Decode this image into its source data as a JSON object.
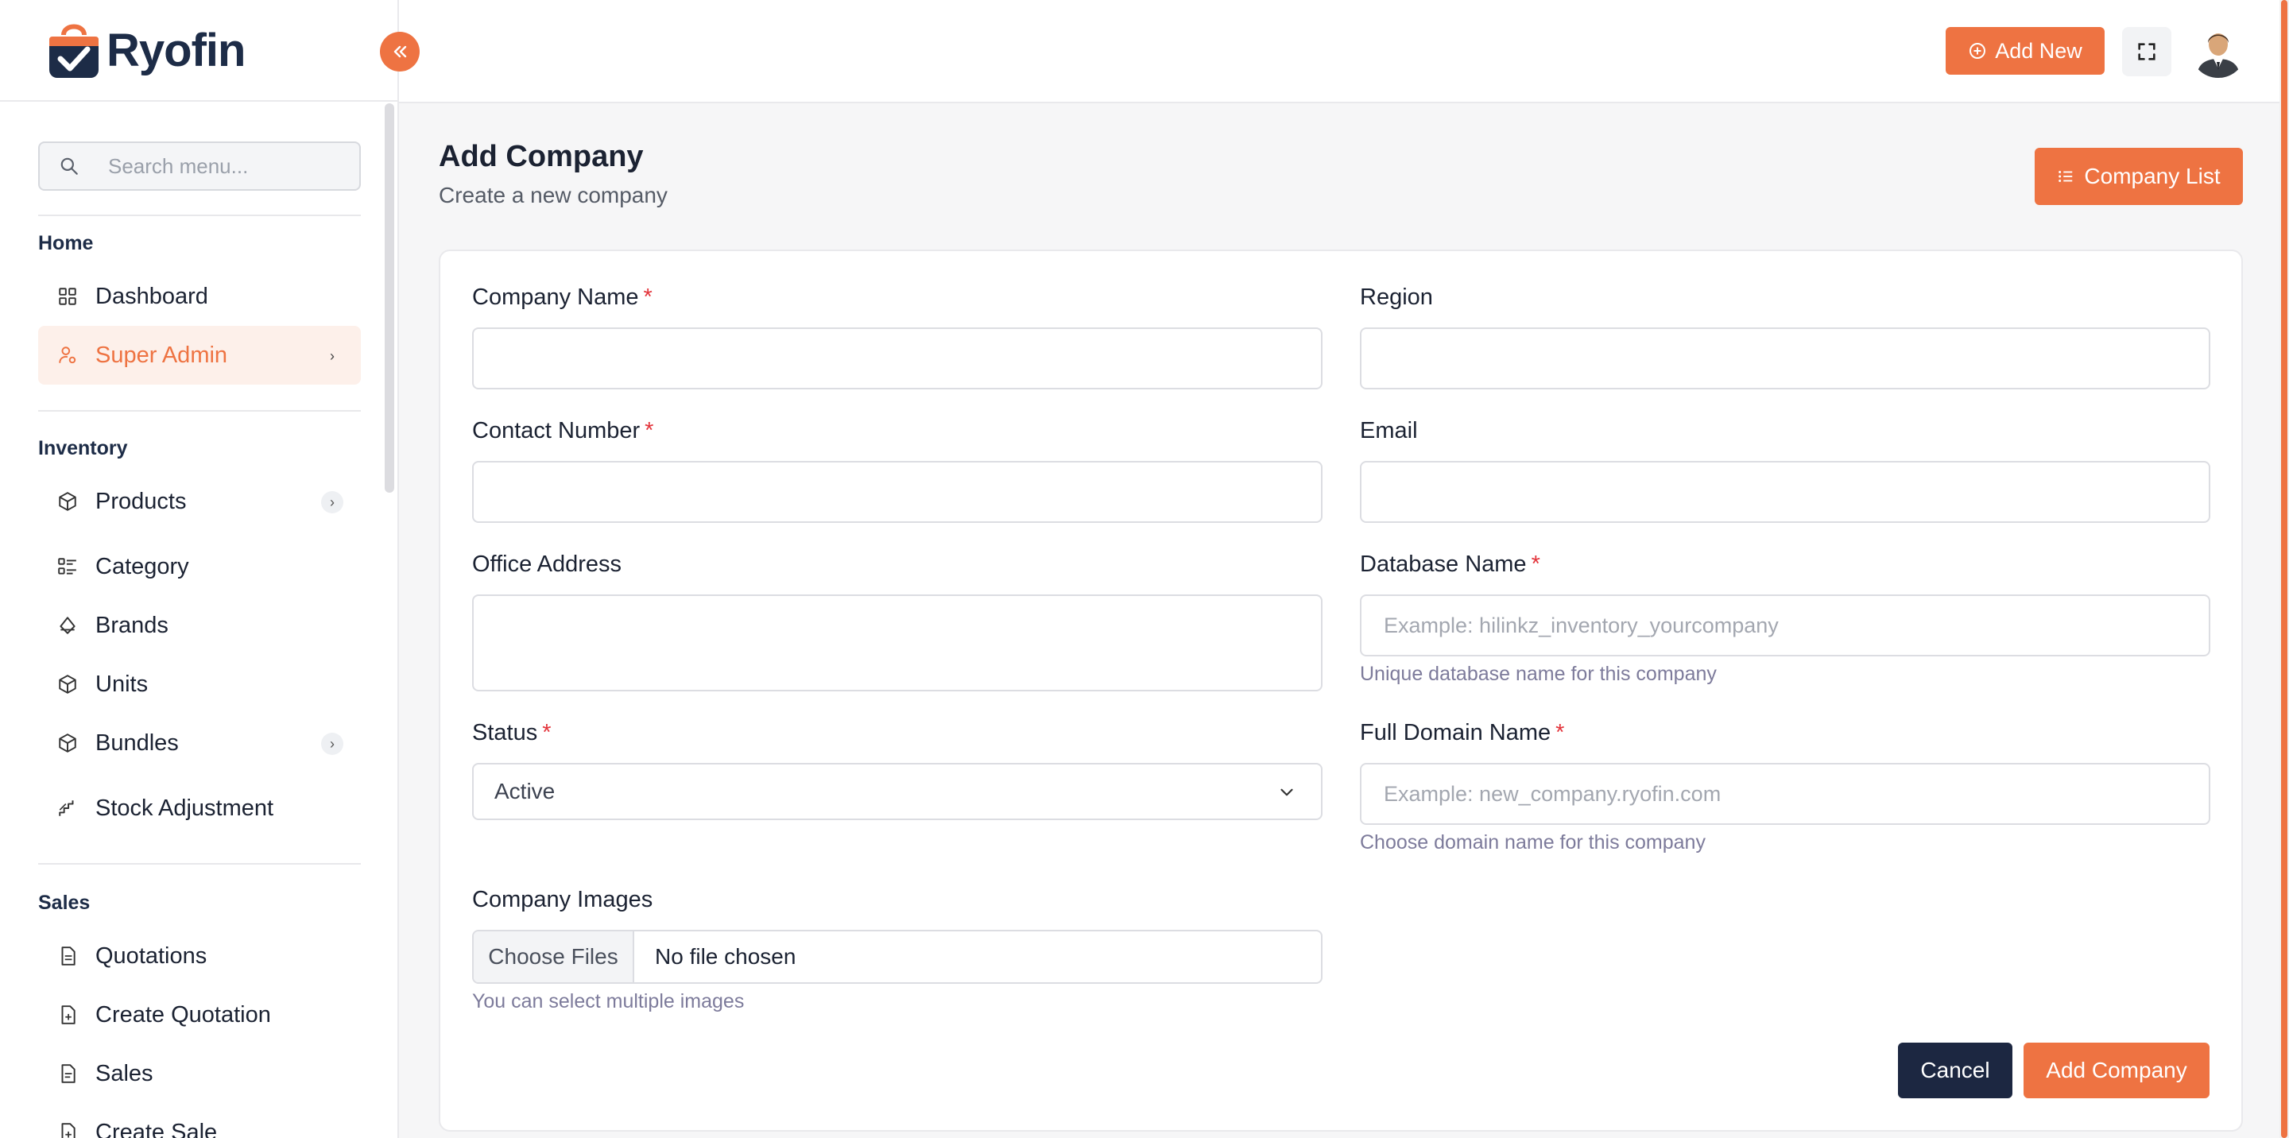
{
  "app": {
    "brand": "Ryofin",
    "accent_color": "#ee7342",
    "dark_color": "#1c2741"
  },
  "sidebar": {
    "search_placeholder": "Search menu...",
    "sections": {
      "home": "Home",
      "inventory": "Inventory",
      "sales": "Sales"
    },
    "items": {
      "dashboard": "Dashboard",
      "super_admin": "Super Admin",
      "products": "Products",
      "category": "Category",
      "brands": "Brands",
      "units": "Units",
      "bundles": "Bundles",
      "stock_adjustment": "Stock Adjustment",
      "quotations": "Quotations",
      "create_quotation": "Create Quotation",
      "sales": "Sales",
      "create_sale": "Create Sale"
    },
    "active_item": "Super Admin"
  },
  "topbar": {
    "add_new_label": "Add New"
  },
  "main": {
    "title": "Add Company",
    "subtitle": "Create a new company",
    "company_list_label": "Company List"
  },
  "form": {
    "company_name": {
      "label": "Company Name",
      "required": "*",
      "value": ""
    },
    "region": {
      "label": "Region",
      "value": ""
    },
    "contact_number": {
      "label": "Contact Number",
      "required": "*",
      "value": ""
    },
    "email": {
      "label": "Email",
      "value": ""
    },
    "office_address": {
      "label": "Office Address",
      "value": ""
    },
    "database_name": {
      "label": "Database Name",
      "required": "*",
      "placeholder": "Example: hilinkz_inventory_yourcompany",
      "hint": "Unique database name for this company"
    },
    "status": {
      "label": "Status",
      "required": "*",
      "value": "Active"
    },
    "domain_name": {
      "label": "Full Domain Name",
      "required": "*",
      "placeholder": "Example: new_company.ryofin.com",
      "hint": "Choose domain name for this company"
    },
    "company_images": {
      "label": "Company Images",
      "button": "Choose Files",
      "status": "No file chosen",
      "hint": "You can select multiple images"
    },
    "cancel_label": "Cancel",
    "submit_label": "Add Company"
  }
}
